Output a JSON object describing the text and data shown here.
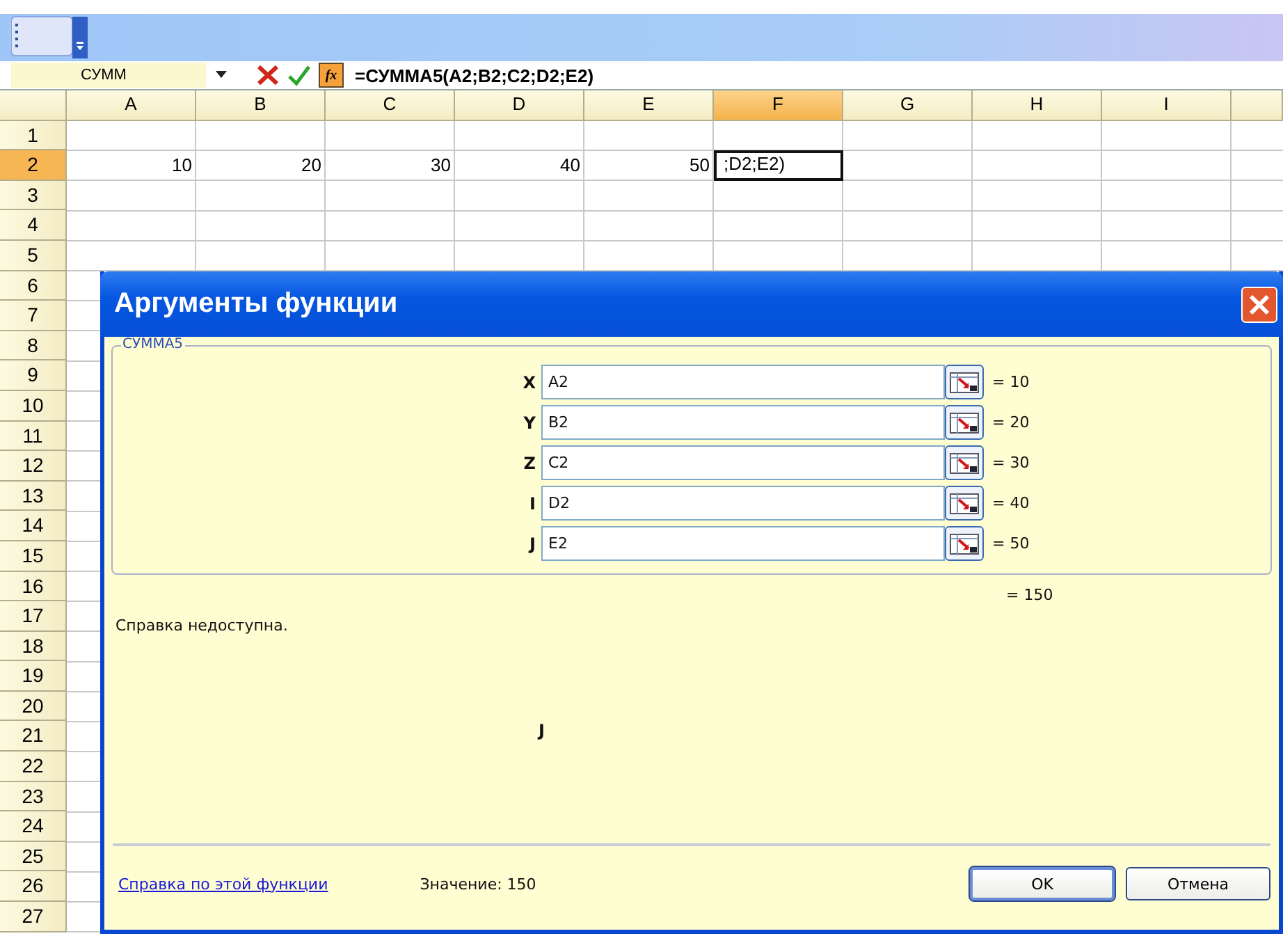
{
  "formula_bar": {
    "name_box": "СУММ",
    "insert_function": "fx",
    "formula": "=СУММА5(A2;B2;C2;D2;E2)"
  },
  "columns": [
    {
      "label": "A",
      "selected": false
    },
    {
      "label": "B",
      "selected": false
    },
    {
      "label": "C",
      "selected": false
    },
    {
      "label": "D",
      "selected": false
    },
    {
      "label": "E",
      "selected": false
    },
    {
      "label": "F",
      "selected": true
    },
    {
      "label": "G",
      "selected": false
    },
    {
      "label": "H",
      "selected": false
    },
    {
      "label": "I",
      "selected": false
    }
  ],
  "rows": [
    {
      "label": "1",
      "selected": false
    },
    {
      "label": "2",
      "selected": true,
      "cells": [
        {
          "value": "10",
          "kind": "number",
          "active": false
        },
        {
          "value": "20",
          "kind": "number",
          "active": false
        },
        {
          "value": "30",
          "kind": "number",
          "active": false
        },
        {
          "value": "40",
          "kind": "number",
          "active": false
        },
        {
          "value": "50",
          "kind": "number",
          "active": false
        },
        {
          "value": ";D2;E2)",
          "kind": "text",
          "active": true
        }
      ]
    },
    {
      "label": "3",
      "selected": false
    },
    {
      "label": "4",
      "selected": false
    },
    {
      "label": "5",
      "selected": false
    },
    {
      "label": "6",
      "selected": false
    },
    {
      "label": "7",
      "selected": false
    },
    {
      "label": "8",
      "selected": false
    },
    {
      "label": "9",
      "selected": false
    },
    {
      "label": "10",
      "selected": false
    },
    {
      "label": "11",
      "selected": false
    },
    {
      "label": "12",
      "selected": false
    },
    {
      "label": "13",
      "selected": false
    },
    {
      "label": "14",
      "selected": false
    },
    {
      "label": "15",
      "selected": false
    },
    {
      "label": "16",
      "selected": false
    },
    {
      "label": "17",
      "selected": false
    },
    {
      "label": "18",
      "selected": false
    },
    {
      "label": "19",
      "selected": false
    },
    {
      "label": "20",
      "selected": false
    },
    {
      "label": "21",
      "selected": false
    },
    {
      "label": "22",
      "selected": false
    },
    {
      "label": "23",
      "selected": false
    },
    {
      "label": "24",
      "selected": false
    },
    {
      "label": "25",
      "selected": false
    },
    {
      "label": "26",
      "selected": false
    },
    {
      "label": "27",
      "selected": false
    }
  ],
  "dialog": {
    "title": "Аргументы функции",
    "group": "СУММА5",
    "arguments": [
      {
        "name": "X",
        "value": "A2",
        "result": "= 10"
      },
      {
        "name": "Y",
        "value": "B2",
        "result": "= 20"
      },
      {
        "name": "Z",
        "value": "C2",
        "result": "= 30"
      },
      {
        "name": "I",
        "value": "D2",
        "result": "= 40"
      },
      {
        "name": "J",
        "value": "E2",
        "result": "= 50"
      }
    ],
    "total": "= 150",
    "description": "Справка недоступна.",
    "argument_help": "J",
    "help_link": "Справка по этой функции",
    "value": "Значение: 150",
    "buttons": [
      {
        "label": "OK",
        "default": true
      },
      {
        "label": "Отмена",
        "default": false
      }
    ]
  }
}
